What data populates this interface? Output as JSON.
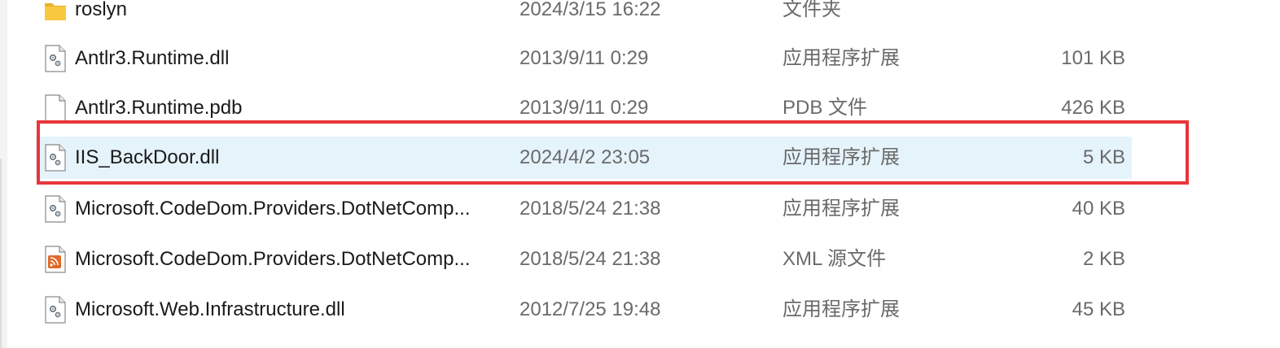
{
  "files": [
    {
      "name": "roslyn",
      "date": "2024/3/15 16:22",
      "type": "文件夹",
      "size": "",
      "icon": "folder-icon"
    },
    {
      "name": "Antlr3.Runtime.dll",
      "date": "2013/9/11 0:29",
      "type": "应用程序扩展",
      "size": "101 KB",
      "icon": "dll-gear-icon"
    },
    {
      "name": "Antlr3.Runtime.pdb",
      "date": "2013/9/11 0:29",
      "type": "PDB 文件",
      "size": "426 KB",
      "icon": "blank-file-icon"
    },
    {
      "name": "IIS_BackDoor.dll",
      "date": "2024/4/2 23:05",
      "type": "应用程序扩展",
      "size": "5 KB",
      "icon": "dll-gear-icon",
      "selected": true
    },
    {
      "name": "Microsoft.CodeDom.Providers.DotNetComp...",
      "date": "2018/5/24 21:38",
      "type": "应用程序扩展",
      "size": "40 KB",
      "icon": "dll-gear-icon"
    },
    {
      "name": "Microsoft.CodeDom.Providers.DotNetComp...",
      "date": "2018/5/24 21:38",
      "type": "XML 源文件",
      "size": "2 KB",
      "icon": "xml-rss-icon"
    },
    {
      "name": "Microsoft.Web.Infrastructure.dll",
      "date": "2012/7/25 19:48",
      "type": "应用程序扩展",
      "size": "45 KB",
      "icon": "dll-gear-icon"
    }
  ],
  "colors": {
    "selection_background": "#e5f3fb",
    "highlight_border": "#e8353b",
    "folder": "#f8c93e",
    "xml_icon": "#e06a2a"
  }
}
